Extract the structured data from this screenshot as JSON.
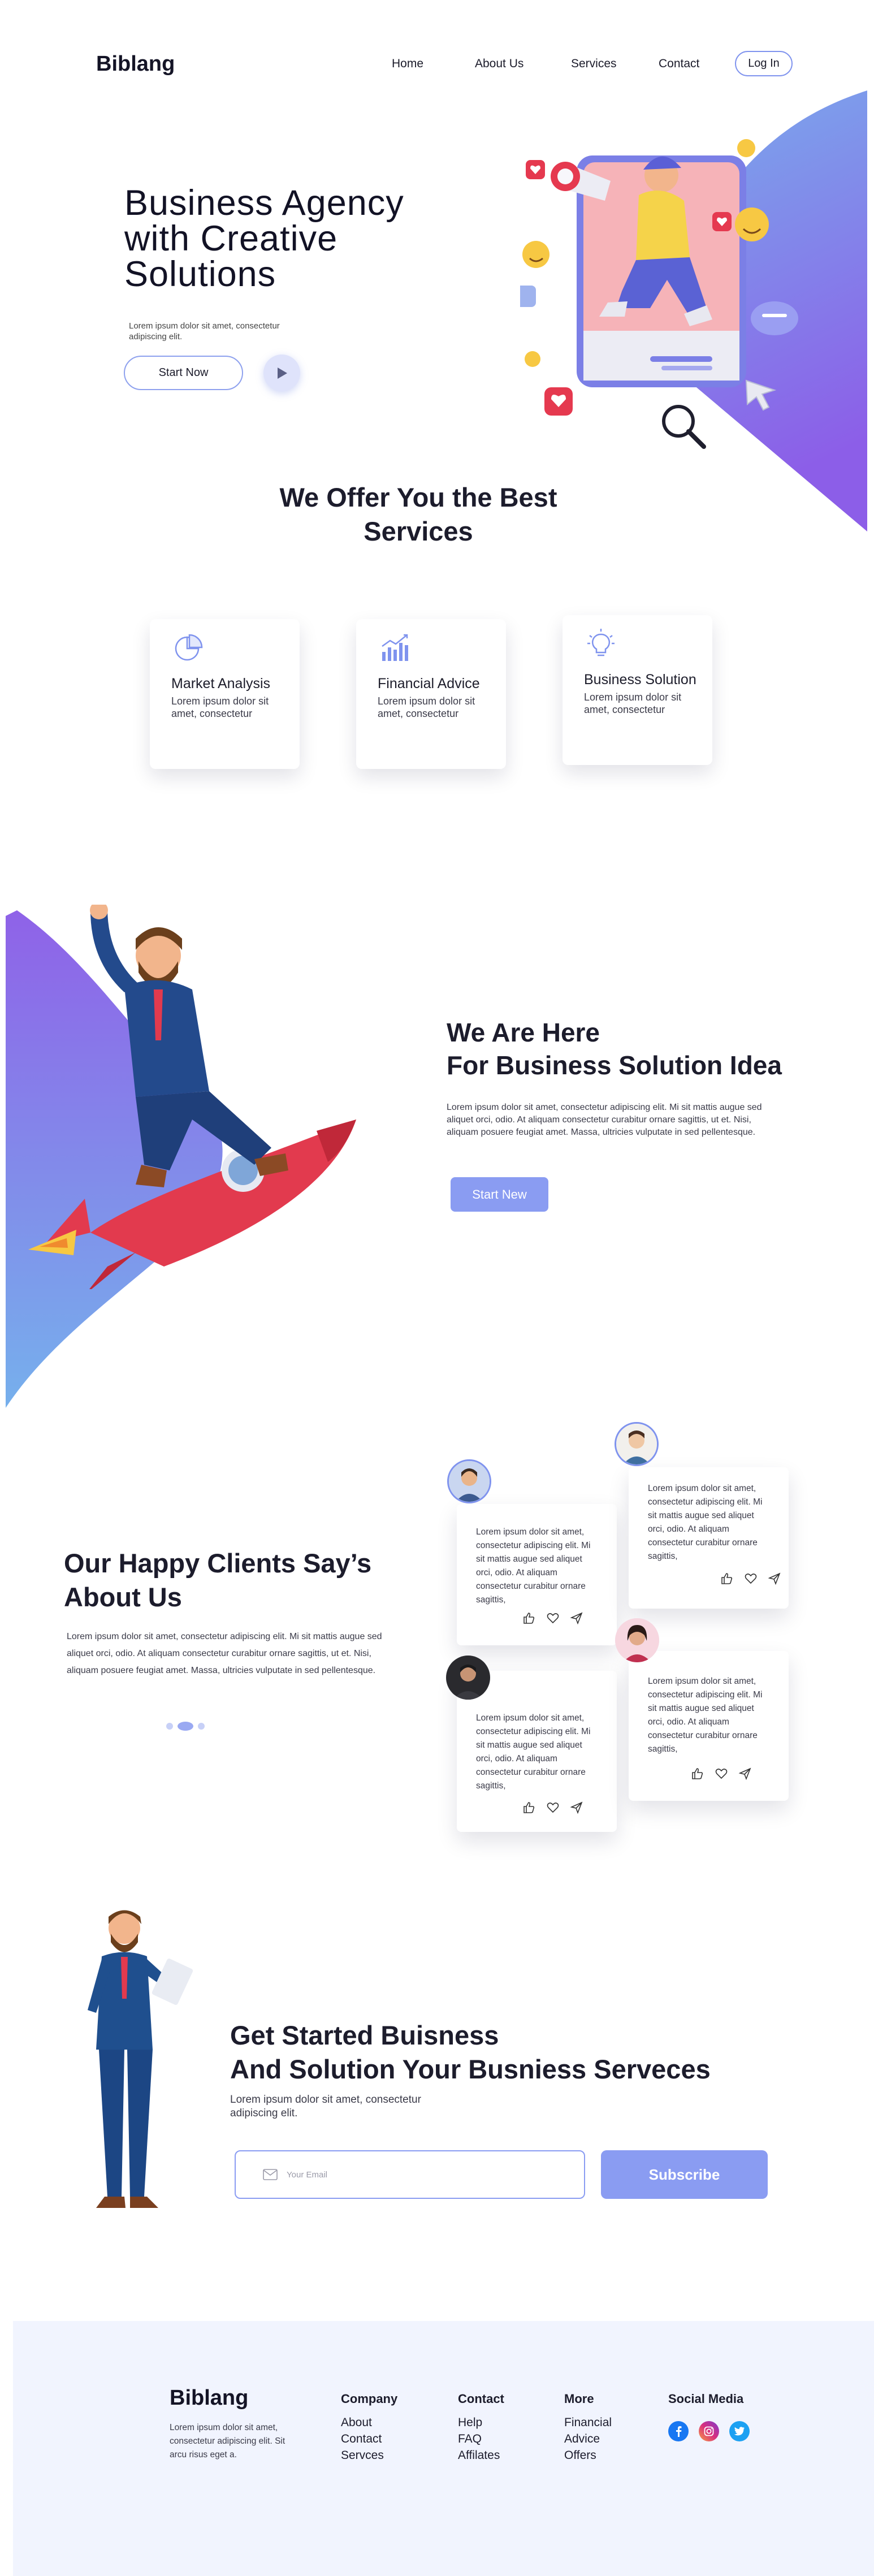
{
  "brand": {
    "name": "Biblang",
    "accent": "#8a9cf2",
    "gradient_from": "#7da6ea",
    "gradient_to": "#8b63e8"
  },
  "nav": {
    "links": [
      "Home",
      "About Us",
      "Services",
      "Contact"
    ],
    "login": "Log In"
  },
  "hero": {
    "title": "Business Agency with Creative Solutions",
    "subtitle": "Lorem ipsum dolor sit amet, consectetur adipiscing elit.",
    "cta": "Start Now"
  },
  "services": {
    "title": "We Offer You the Best Services",
    "cards": [
      {
        "title": "Market Analysis",
        "text": "Lorem ipsum dolor sit amet, consectetur",
        "icon": "pie-chart-icon"
      },
      {
        "title": "Financial Advice",
        "text": "Lorem ipsum dolor sit amet, consectetur",
        "icon": "bar-chart-icon"
      },
      {
        "title": "Business Solution",
        "text": "Lorem ipsum dolor sit amet, consectetur",
        "icon": "lightbulb-icon"
      }
    ]
  },
  "about": {
    "title_line1": "We Are Here",
    "title_line2": "For Business Solution Idea",
    "text": "Lorem ipsum dolor sit amet, consectetur adipiscing elit. Mi sit mattis augue sed aliquet orci, odio. At aliquam consectetur curabitur ornare sagittis, ut et. Nisi, aliquam posuere feugiat amet. Massa, ultricies vulputate in sed pellentesque.",
    "cta": "Start New"
  },
  "testimonials": {
    "title_line1": "Our Happy Clients Say’s",
    "title_line2": "About Us",
    "text": "Lorem ipsum dolor sit amet, consectetur adipiscing elit. Mi sit mattis augue sed aliquet orci, odio. At aliquam consectetur curabitur ornare sagittis, ut et. Nisi, aliquam posuere feugiat amet. Massa, ultricies vulputate in sed pellentesque.",
    "reviews": [
      {
        "text": "Lorem ipsum dolor sit amet, consectetur adipiscing elit. Mi sit mattis augue sed aliquet orci, odio. At aliquam consectetur curabitur ornare sagittis,"
      },
      {
        "text": "Lorem ipsum dolor sit amet, consectetur adipiscing elit. Mi sit mattis augue sed aliquet orci, odio. At aliquam consectetur curabitur ornare sagittis,"
      },
      {
        "text": "Lorem ipsum dolor sit amet, consectetur adipiscing elit. Mi sit mattis augue sed aliquet orci, odio. At aliquam consectetur curabitur ornare sagittis,"
      },
      {
        "text": "Lorem ipsum dolor sit amet, consectetur adipiscing elit. Mi sit mattis augue sed aliquet orci, odio. At aliquam consectetur curabitur ornare sagittis,"
      }
    ]
  },
  "subscribe": {
    "title_line1": "Get Started Buisness",
    "title_line2": "And Solution Your Busniess Serveces",
    "text": "Lorem ipsum dolor sit amet, consectetur adipiscing elit.",
    "placeholder": "Your Email",
    "button": "Subscribe"
  },
  "footer": {
    "logo": "Biblang",
    "text": "Lorem ipsum dolor sit amet, consectetur adipiscing elit. Sit arcu risus eget a.",
    "columns": [
      {
        "heading": "Company",
        "links": [
          "About",
          "Contact",
          "Servces"
        ]
      },
      {
        "heading": "Contact",
        "links": [
          "Help",
          "FAQ",
          "Affilates"
        ]
      },
      {
        "heading": "More",
        "links": [
          "Financial",
          "Advice",
          "Offers"
        ]
      }
    ],
    "social_heading": "Social Media",
    "social": [
      "facebook-icon",
      "instagram-icon",
      "twitter-icon"
    ]
  }
}
